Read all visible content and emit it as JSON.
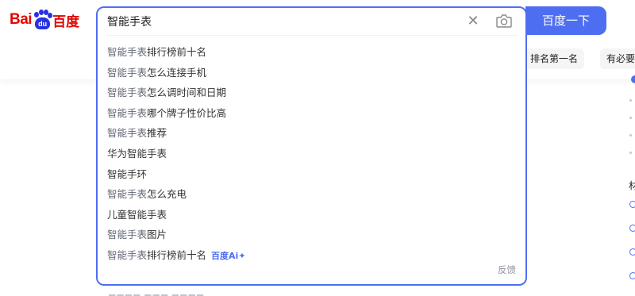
{
  "logo": {
    "text_left": "Bai",
    "paw_text": "du",
    "text_right": "百度"
  },
  "search": {
    "value": "智能手表",
    "placeholder": "",
    "button_label": "百度一下"
  },
  "suggestions": [
    {
      "query": "智能手表",
      "rest": "排行榜前十名"
    },
    {
      "query": "智能手表",
      "rest": "怎么连接手机"
    },
    {
      "query": "智能手表",
      "rest": "怎么调时间和日期"
    },
    {
      "query": "智能手表",
      "rest": "哪个牌子性价比高"
    },
    {
      "query": "智能手表",
      "rest": "推荐"
    },
    {
      "query": "",
      "rest": "华为智能手表"
    },
    {
      "query": "",
      "rest": "智能手环"
    },
    {
      "query": "智能手表",
      "rest": "怎么充电"
    },
    {
      "query": "",
      "rest": "儿童智能手表"
    },
    {
      "query": "智能手表",
      "rest": "图片"
    },
    {
      "query": "智能手表",
      "rest": "排行榜前十名",
      "ai_badge": "百度Ai✦"
    }
  ],
  "feedback_label": "反馈",
  "chips": [
    "排名第一名",
    "有必要"
  ],
  "right_column": {
    "char": "材"
  },
  "colors": {
    "accent": "#4e6ef2",
    "brand_red": "#e10602",
    "paw_blue": "#2932e1"
  }
}
